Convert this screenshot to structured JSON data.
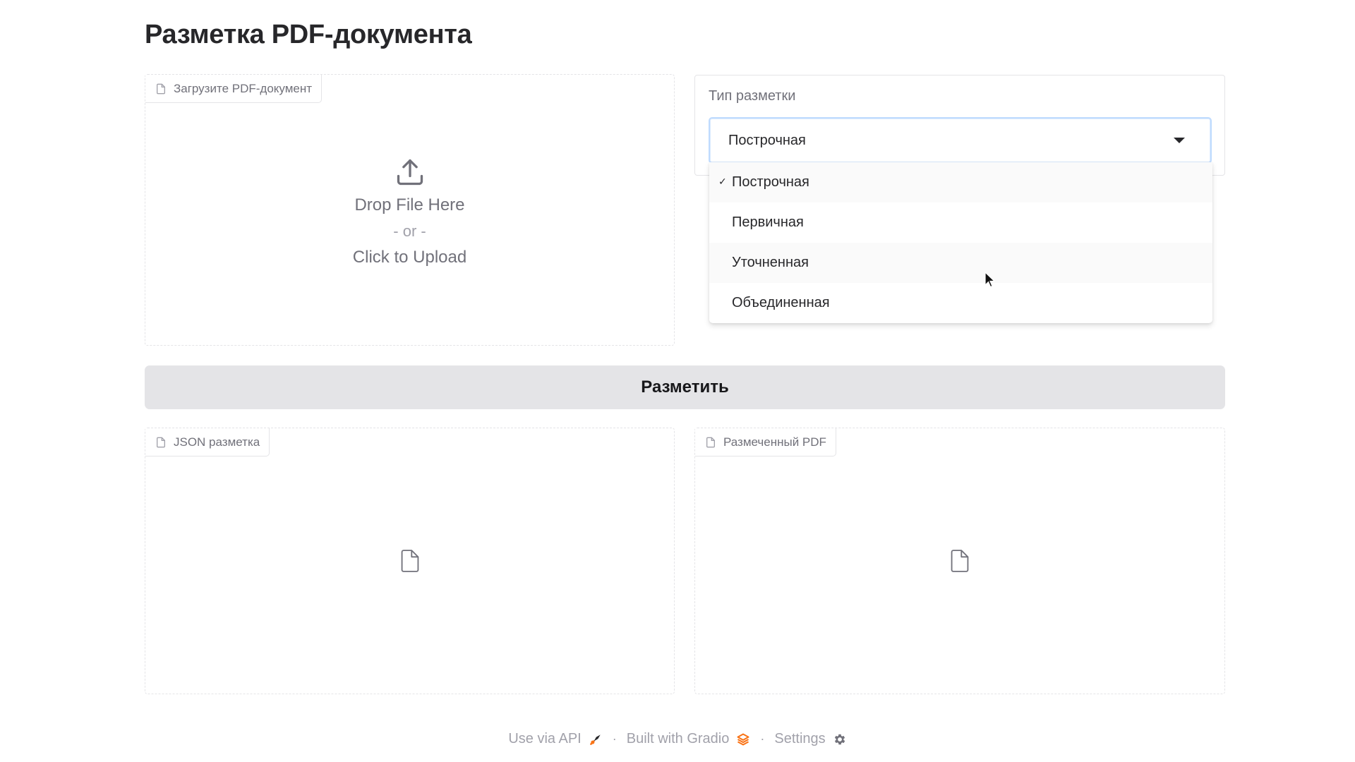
{
  "page": {
    "title": "Разметка PDF-документа"
  },
  "upload": {
    "label": "Загрузите PDF-документ",
    "drop_text": "Drop File Here",
    "or_text": "- or -",
    "click_text": "Click to Upload"
  },
  "markup_type": {
    "label": "Тип разметки",
    "selected": "Построчная",
    "options": [
      "Построчная",
      "Первичная",
      "Уточненная",
      "Объединенная"
    ],
    "check_mark": "✓"
  },
  "actions": {
    "mark_label": "Разметить"
  },
  "outputs": {
    "json_label": "JSON разметка",
    "pdf_label": "Размеченный PDF"
  },
  "footer": {
    "api_label": "Use via API",
    "gradio_label": "Built with Gradio",
    "settings_label": "Settings",
    "separator": "·"
  },
  "colors": {
    "accent_border": "#bfdbfe",
    "button_bg": "#e4e4e7",
    "gradio_orange": "#f97316",
    "muted_text": "#71717a"
  }
}
